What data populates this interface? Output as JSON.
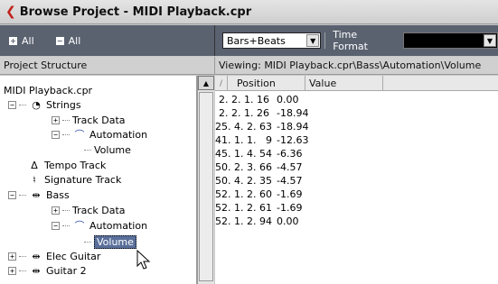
{
  "window": {
    "title": "Browse Project - MIDI Playback.cpr"
  },
  "left_toolbar": {
    "expand_all_label": "All",
    "collapse_all_label": "All"
  },
  "right_toolbar": {
    "format_value": "Bars+Beats",
    "time_format_label": "Time Format",
    "secondary_value": ""
  },
  "left_panel": {
    "header": "Project Structure"
  },
  "right_panel": {
    "viewing": "Viewing: MIDI Playback.cpr\\Bass\\Automation\\Volume"
  },
  "tree": [
    {
      "label": "MIDI Playback.cpr"
    },
    {
      "label": "Strings"
    },
    {
      "label": "Track Data"
    },
    {
      "label": "Automation"
    },
    {
      "label": "Volume"
    },
    {
      "label": "Tempo Track"
    },
    {
      "label": "Signature Track"
    },
    {
      "label": "Bass"
    },
    {
      "label": "Track Data"
    },
    {
      "label": "Automation"
    },
    {
      "label": "Volume"
    },
    {
      "label": "Elec Guitar"
    },
    {
      "label": "Guitar 2"
    }
  ],
  "table": {
    "columns": [
      "Position",
      "Value"
    ],
    "rows": [
      {
        "position": "2. 2. 1. 16",
        "value": "0.00"
      },
      {
        "position": "2. 2. 1. 26",
        "value": "-18.94"
      },
      {
        "position": "25. 4. 2. 63",
        "value": "-18.94"
      },
      {
        "position": "41. 1. 1.   9",
        "value": "-12.63"
      },
      {
        "position": "45. 1. 4. 54",
        "value": "-6.36"
      },
      {
        "position": "50. 2. 3. 66",
        "value": "-4.57"
      },
      {
        "position": "50. 4. 2. 35",
        "value": "-4.57"
      },
      {
        "position": "52. 1. 2. 60",
        "value": "-1.69"
      },
      {
        "position": "52. 1. 2. 61",
        "value": "-1.69"
      },
      {
        "position": "52. 1. 2. 94",
        "value": "0.00"
      }
    ]
  },
  "colors": {
    "toolbar": "#5a6270",
    "selection": "#5a6f9a",
    "close_arrow": "#c0201a"
  }
}
